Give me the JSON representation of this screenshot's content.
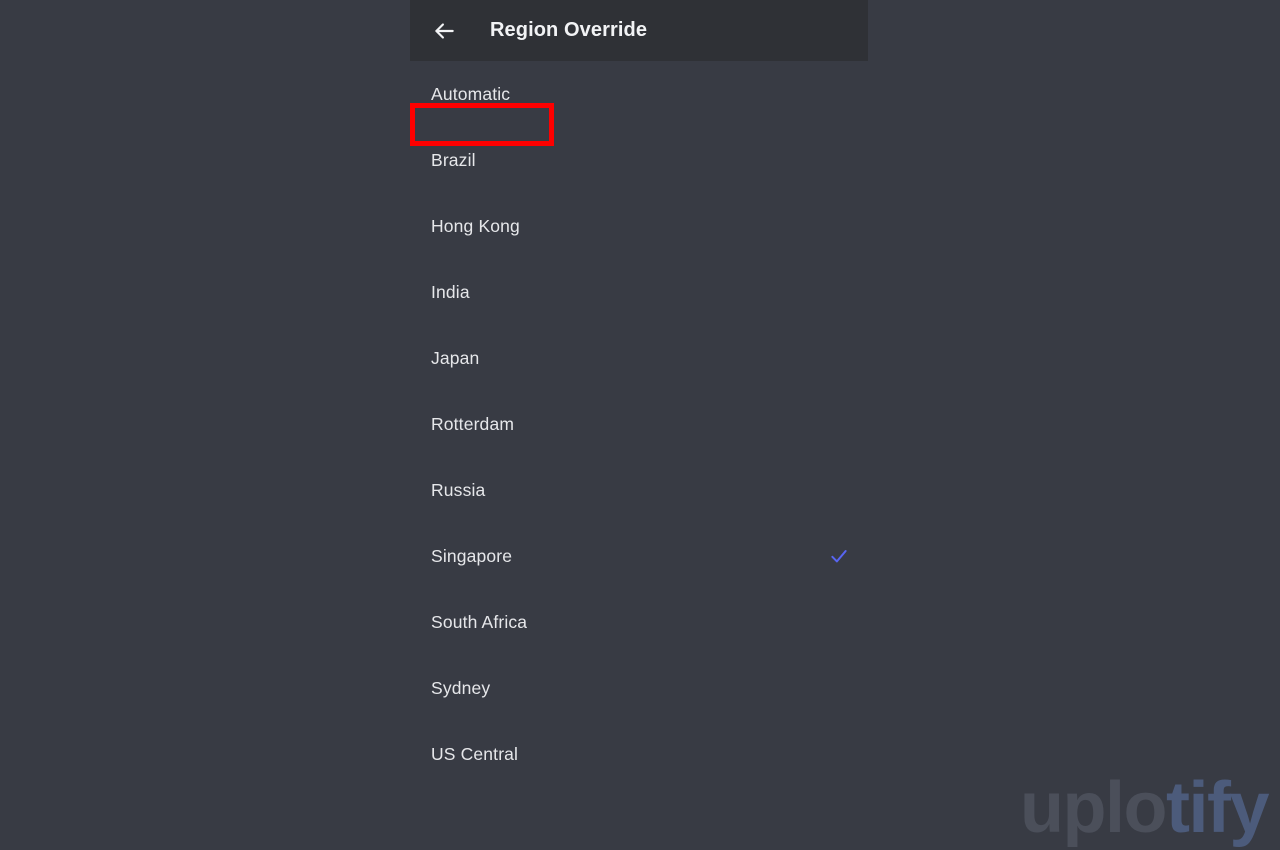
{
  "header": {
    "title": "Region Override",
    "back_icon": "arrow-left-icon",
    "background_color": "#2f3136"
  },
  "page": {
    "background_color": "#383b44",
    "text_color": "#e6e7ea"
  },
  "annotation": {
    "highlight_color": "#fe0000",
    "highlight_target": "Automatic"
  },
  "regions": {
    "check_icon": "checkmark-icon",
    "check_color": "#5865f2",
    "items": [
      {
        "label": "Automatic",
        "selected": false,
        "highlighted": true
      },
      {
        "label": "Brazil",
        "selected": false,
        "highlighted": false
      },
      {
        "label": "Hong Kong",
        "selected": false,
        "highlighted": false
      },
      {
        "label": "India",
        "selected": false,
        "highlighted": false
      },
      {
        "label": "Japan",
        "selected": false,
        "highlighted": false
      },
      {
        "label": "Rotterdam",
        "selected": false,
        "highlighted": false
      },
      {
        "label": "Russia",
        "selected": false,
        "highlighted": false
      },
      {
        "label": "Singapore",
        "selected": true,
        "highlighted": false
      },
      {
        "label": "South Africa",
        "selected": false,
        "highlighted": false
      },
      {
        "label": "Sydney",
        "selected": false,
        "highlighted": false
      },
      {
        "label": "US Central",
        "selected": false,
        "highlighted": false
      }
    ]
  },
  "watermark": {
    "text_part_1": "uplo",
    "text_part_2": "tify",
    "color_1": "#4b4f5a",
    "color_2": "#4c5b7b"
  }
}
